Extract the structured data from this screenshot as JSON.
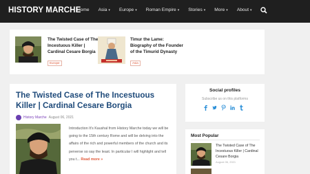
{
  "nav": {
    "brand": "HISTORY MARCHE",
    "items": [
      {
        "label": "Home",
        "has_caret": false
      },
      {
        "label": "Asia",
        "has_caret": true
      },
      {
        "label": "Europe",
        "has_caret": true
      },
      {
        "label": "Roman Empire",
        "has_caret": true
      },
      {
        "label": "Stories",
        "has_caret": true
      },
      {
        "label": "More",
        "has_caret": true
      },
      {
        "label": "About",
        "has_caret": true
      }
    ],
    "search_icon": "search-icon"
  },
  "featured": [
    {
      "title": "The Twisted Case of The Incestuous Killer | Cardinal Cesare Borgia",
      "tag": "Europe"
    },
    {
      "title": "Timur the Lame: Biography of the Founder of the Timurid Dynasty",
      "tag": "Asia"
    }
  ],
  "article": {
    "title": "The Twisted Case of The Incestuous Killer | Cardinal Cesare Borgia",
    "author": "History Marche",
    "date": "August 06, 2021",
    "excerpt": "Introduction It's Kaushal from History Marche today we will be going to the 15th century Rome and will be delving into the affairs of the rich and powerful members of the church and its perverse so say the least. In particular I will highlight and tell you t...",
    "read_more": "Read more »"
  },
  "social": {
    "title": "Social profiles",
    "subtitle": "Subscribe us on this platforms",
    "icons": [
      "facebook-icon",
      "twitter-icon",
      "pinterest-icon",
      "linkedin-icon",
      "tumblr-icon"
    ],
    "colors": {
      "accent": "#2a8fd8"
    }
  },
  "popular": {
    "title": "Most Popular",
    "item": {
      "title": "The Twisted Case of The Incestuous Killer | Cardinal Cesare Borgia",
      "date": "August 06, 2021"
    }
  }
}
